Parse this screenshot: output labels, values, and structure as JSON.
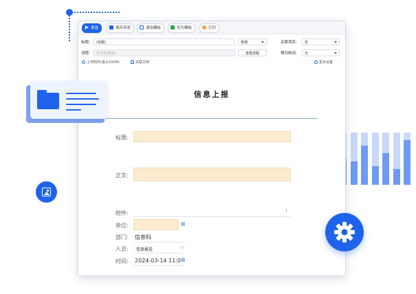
{
  "toolbar": {
    "send": "发送",
    "save_draft": "保存待发",
    "use_template": "调用模板",
    "save_as_template": "存为模板",
    "print": "打印"
  },
  "header": {
    "title_label": "标题:",
    "title_value": "(标题)",
    "priority_value": "普通",
    "related_project_label": "关联项目:",
    "related_project_value": "无",
    "process_label": "流程:",
    "process_placeholder": "空节点(知会)",
    "view_process_button": "查看流程",
    "budget_label": "预归档到:",
    "budget_value": "无",
    "upload_label": "上传附件(最大100M)",
    "related_doc_label": "关联文档",
    "more_settings": "更多设置"
  },
  "form": {
    "title": "信息上报",
    "title_field_label": "标题:",
    "body_label": "正文:",
    "attachment_label": "附件:",
    "unit_label": "单位:",
    "department_label": "部门:",
    "department_value": "信息科",
    "person_label": "人员:",
    "person_value": "信息报送",
    "time_label": "时间:",
    "time_value": "2024-03-14 11:0"
  },
  "colors": {
    "accent": "#1f63ea",
    "field_fill": "#fdebcf",
    "bar_light": "#c8d8f9",
    "bar_dark": "#6e9af1"
  },
  "decor": {
    "bar_levels": [
      0.55,
      0.3,
      0.5,
      0.45,
      0.75,
      0.35,
      0.6,
      0.3,
      0.85
    ],
    "icons": [
      "folder-icon",
      "image-icon",
      "gear-icon"
    ]
  }
}
